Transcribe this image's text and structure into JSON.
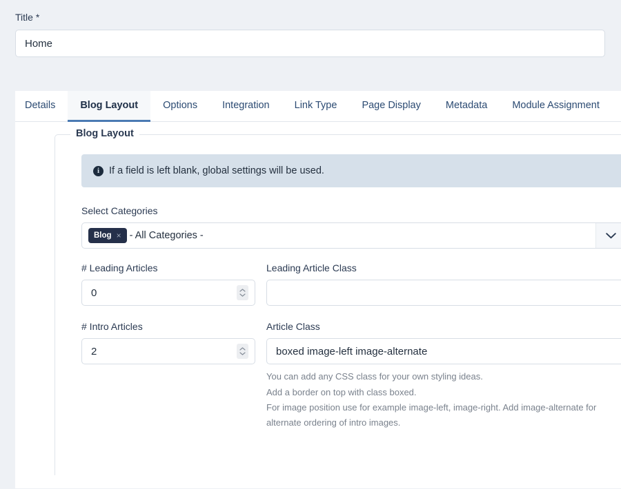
{
  "title_field": {
    "label": "Title *",
    "value": "Home"
  },
  "tabs": [
    {
      "label": "Details",
      "active": false
    },
    {
      "label": "Blog Layout",
      "active": true
    },
    {
      "label": "Options",
      "active": false
    },
    {
      "label": "Integration",
      "active": false
    },
    {
      "label": "Link Type",
      "active": false
    },
    {
      "label": "Page Display",
      "active": false
    },
    {
      "label": "Metadata",
      "active": false
    },
    {
      "label": "Module Assignment",
      "active": false
    }
  ],
  "fieldset": {
    "legend": "Blog Layout",
    "alert": {
      "icon": "info-circle-icon",
      "text": "If a field is left blank, global settings will be used."
    },
    "select_categories": {
      "label": "Select Categories",
      "chips": [
        {
          "label": "Blog",
          "remove": "×"
        }
      ],
      "placeholder": "- All Categories -",
      "arrow_icon": "chevron-down-icon"
    },
    "leading_articles": {
      "label": "# Leading Articles",
      "value": "0"
    },
    "leading_article_class": {
      "label": "Leading Article Class",
      "value": ""
    },
    "intro_articles": {
      "label": "# Intro Articles",
      "value": "2"
    },
    "article_class": {
      "label": "Article Class",
      "value": "boxed image-left image-alternate",
      "help_lines": [
        "You can add any CSS class for your own styling ideas.",
        "Add a border on top with class boxed.",
        "For image position use for example image-left, image-right. Add image-alternate for alternate ordering of intro images."
      ]
    }
  },
  "colors": {
    "page_background": "#eef1f5",
    "panel": "#ffffff",
    "accent": "#4a7ab3",
    "chip": "#25304a",
    "alert_background": "#d6e0ea",
    "border": "#d7dde5",
    "help_text": "#7a828d"
  }
}
